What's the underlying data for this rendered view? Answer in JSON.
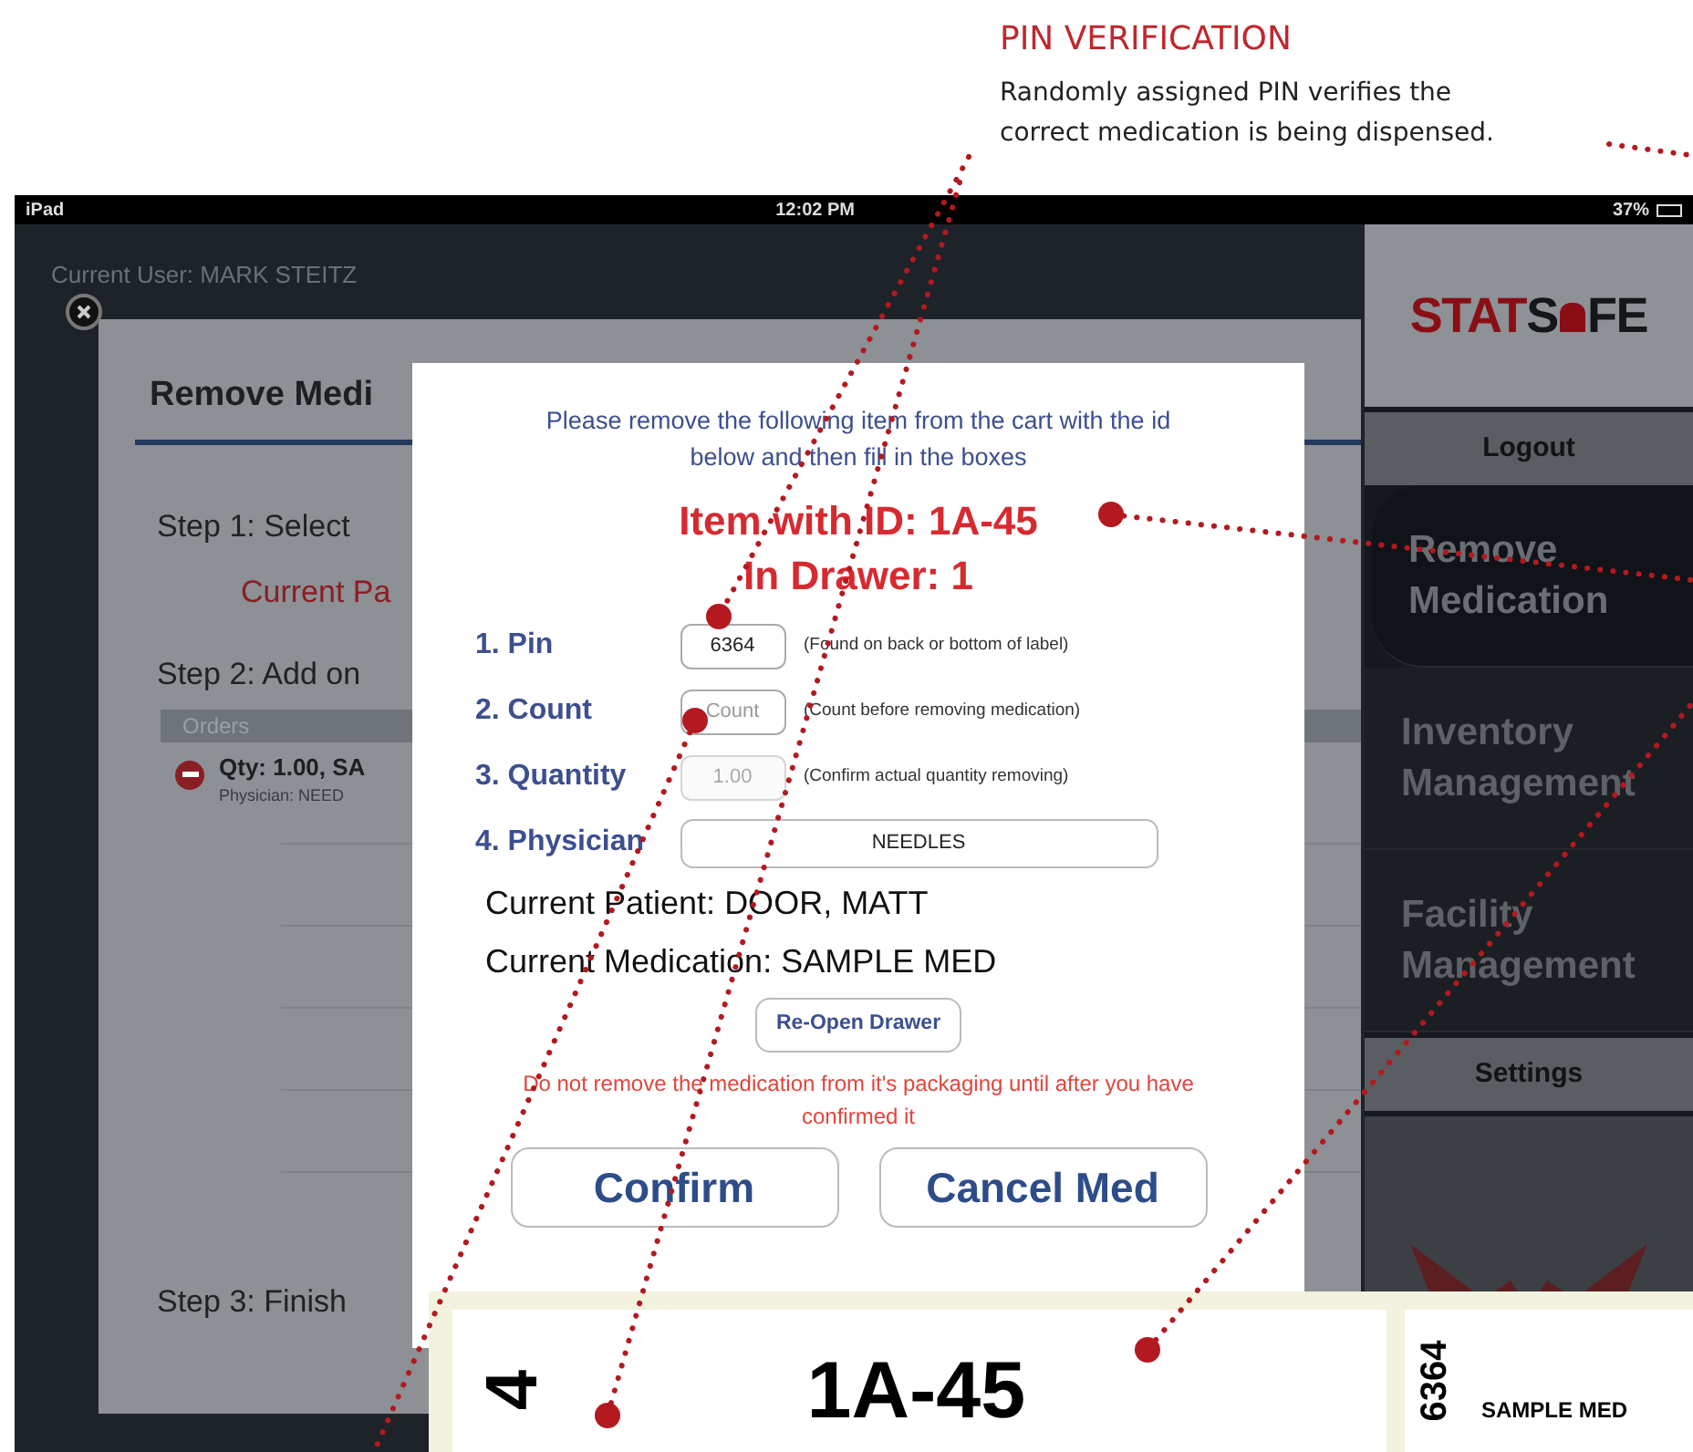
{
  "callout": {
    "title": "PIN VERIFICATION",
    "text": "Randomly assigned PIN verifies the correct medication is being dispensed."
  },
  "status_bar": {
    "carrier": "iPad",
    "time": "12:02 PM",
    "battery": "37%"
  },
  "current_user": "Current User: MARK STEITZ",
  "background_panel": {
    "title": "Remove Medi",
    "step_1": "Step 1:  Select",
    "current_patient": "Current Pa",
    "step_2": "Step 2:  Add on",
    "orders_header": "Orders",
    "order": {
      "qty": "Qty: 1.00, SA",
      "physician": "Physician: NEED"
    },
    "step_3": "Step 3:  Finish"
  },
  "sidebar": {
    "logo": {
      "left": "STAT",
      "right": "S",
      "tail": "FE"
    },
    "items": [
      {
        "kind": "button",
        "label": "Logout",
        "selected": false
      },
      {
        "kind": "nav",
        "label": "Remove Medication",
        "selected": true
      },
      {
        "kind": "nav",
        "label": "Inventory Management",
        "selected": false
      },
      {
        "kind": "nav",
        "label": "Facility Management",
        "selected": false
      },
      {
        "kind": "button",
        "label": "Settings",
        "selected": false
      }
    ]
  },
  "modal": {
    "instruction": "Please remove the following item from the cart with the id below and then fill in the boxes",
    "item_line": "Item with ID: 1A-45",
    "drawer_line": "In Drawer: 1",
    "fields": [
      {
        "kind": "short",
        "number": "1.",
        "label": "Pin",
        "value": "6364",
        "disabled": false,
        "hint": "(Found on back or bottom of label)"
      },
      {
        "kind": "short",
        "number": "2.",
        "label": "Count",
        "placeholder": "Count",
        "disabled": false,
        "hint": "(Count before removing medication)"
      },
      {
        "kind": "short",
        "number": "3.",
        "label": "Quantity",
        "value": "1.00",
        "disabled": true,
        "hint": "(Confirm actual quantity removing)"
      },
      {
        "kind": "wide",
        "number": "4.",
        "label": "Physician",
        "value": "NEEDLES",
        "disabled": false
      }
    ],
    "patient": "Current Patient: DOOR, MATT",
    "medication": "Current Medication: SAMPLE MED",
    "reopen_button": "Re-Open Drawer",
    "warning": "Do not remove the medication from it's packaging until after you have confirmed it",
    "buttons": [
      "Confirm",
      "Cancel Med"
    ]
  },
  "labels": [
    {
      "kind": "id",
      "pin": "4",
      "id": "1A-45"
    },
    {
      "kind": "med",
      "pin": "6364",
      "name": "SAMPLE MED"
    }
  ]
}
